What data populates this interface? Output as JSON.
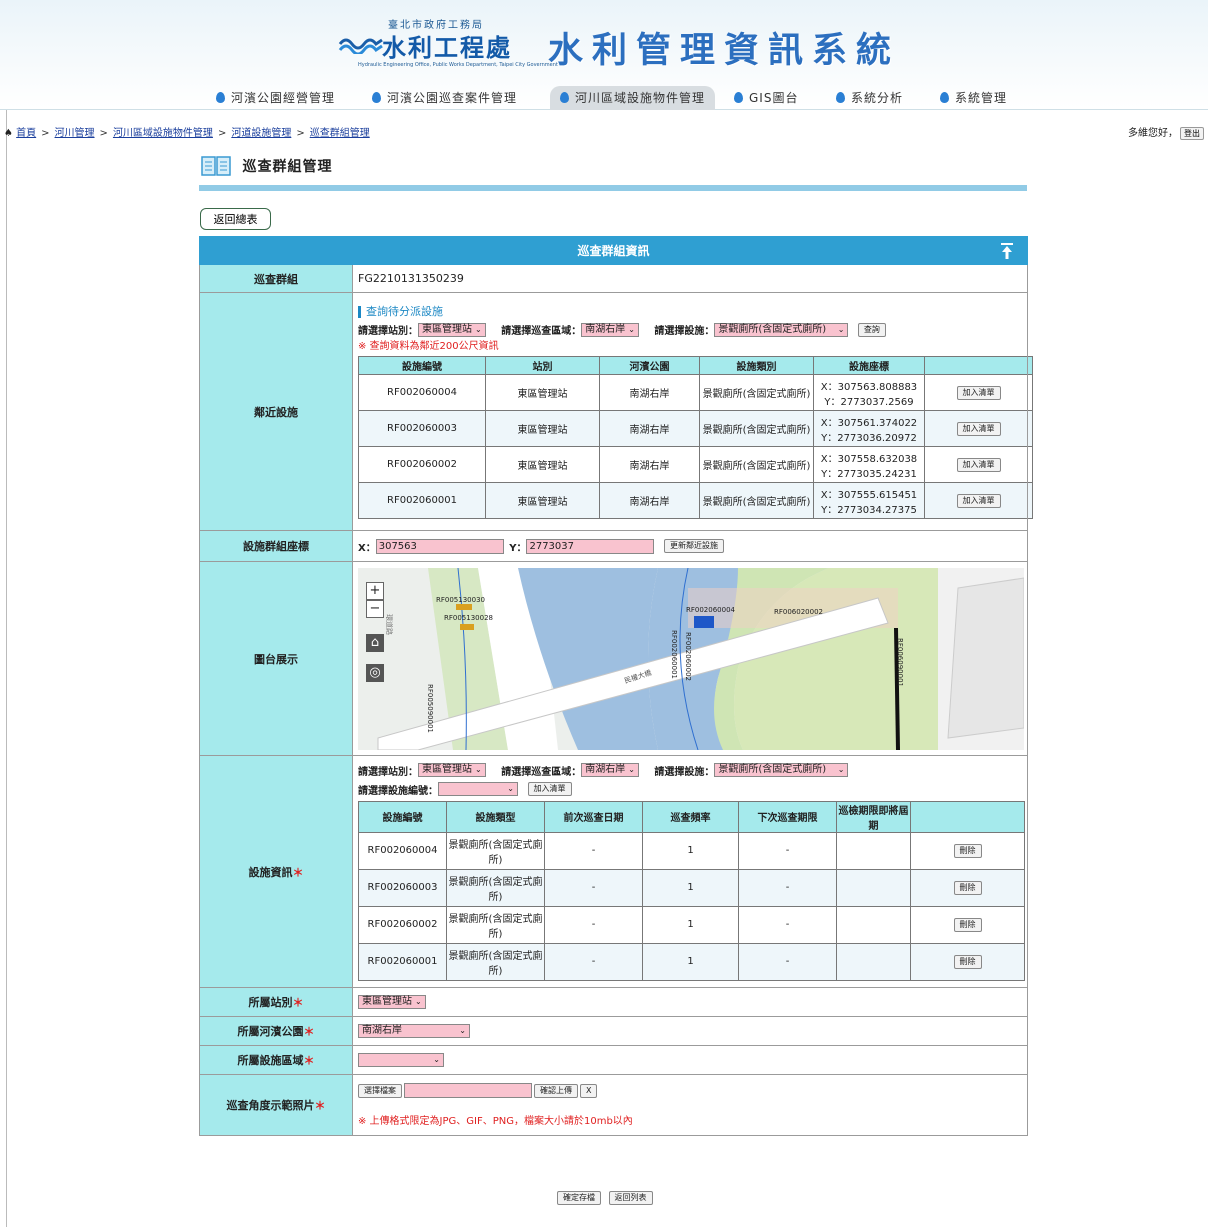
{
  "header": {
    "org_line1": "臺北市政府工務局",
    "org_line2": "水利工程處",
    "org_line3": "Hydraulic Engineering Office, Public Works Department, Taipei City Government",
    "system_title": "水利管理資訊系統"
  },
  "nav": {
    "items": [
      {
        "label": "河濱公園經營管理"
      },
      {
        "label": "河濱公園巡查案件管理"
      },
      {
        "label": "河川區域設施物件管理"
      },
      {
        "label": "GIS圖台"
      },
      {
        "label": "系統分析"
      },
      {
        "label": "系統管理"
      }
    ],
    "accent": "#2a7fd4"
  },
  "breadcrumb": {
    "items": [
      "首頁",
      "河川管理",
      "河川區域設施物件管理",
      "河道設施管理",
      "巡查群組管理"
    ],
    "separator": ">"
  },
  "user": {
    "greeting": "多維您好，",
    "logout": "登出"
  },
  "page_title": "巡查群組管理",
  "back_button": "返回總表",
  "panel": {
    "caption": "巡查群組資訊",
    "group_label": "巡查群組",
    "group_value": "FG2210131350239",
    "nearby_label": "鄰近設施",
    "query_heading": "查詢待分派設施",
    "q_station_label": "請選擇站別：",
    "q_station_value": "東區管理站",
    "q_area_label": "請選擇巡查區域：",
    "q_area_value": "南湖右岸",
    "q_facility_label": "請選擇設施：",
    "q_facility_value": "景觀廁所(含固定式廁所)",
    "query_button": "查詢",
    "query_note": "※ 查詢資料為鄰近200公尺資訊",
    "nearby_headers": [
      "設施編號",
      "站別",
      "河濱公園",
      "設施類別",
      "設施座標",
      ""
    ],
    "nearby_rows": [
      {
        "id": "RF002060004",
        "station": "東區管理站",
        "park": "南湖右岸",
        "type": "景觀廁所(含固定式廁所)",
        "x": "X：307563.808883",
        "y": "Y：2773037.2569",
        "btn": "加入清單"
      },
      {
        "id": "RF002060003",
        "station": "東區管理站",
        "park": "南湖右岸",
        "type": "景觀廁所(含固定式廁所)",
        "x": "X：307561.374022",
        "y": "Y：2773036.20972",
        "btn": "加入清單"
      },
      {
        "id": "RF002060002",
        "station": "東區管理站",
        "park": "南湖右岸",
        "type": "景觀廁所(含固定式廁所)",
        "x": "X：307558.632038",
        "y": "Y：2773035.24231",
        "btn": "加入清單"
      },
      {
        "id": "RF002060001",
        "station": "東區管理站",
        "park": "南湖右岸",
        "type": "景觀廁所(含固定式廁所)",
        "x": "X：307555.615451",
        "y": "Y：2773034.27375",
        "btn": "加入清單"
      }
    ],
    "coord_label": "設施群組座標",
    "coord_x_prefix": "X：",
    "coord_x": "307563",
    "coord_y_prefix": "Y：",
    "coord_y": "2773037",
    "coord_button": "更新鄰近設施",
    "map_label": "圖台展示",
    "map": {
      "labels": [
        "RF005130030",
        "RF005130028",
        "RF002060004",
        "RF006020002",
        "RF005090001",
        "RF006090001",
        "RF002060001",
        "RF002060002",
        "民權大橋",
        "環道路"
      ],
      "zoom_in": "+",
      "zoom_out": "−"
    },
    "info_label": "設施資訊",
    "i_station_label": "請選擇站別：",
    "i_station_value": "東區管理站",
    "i_area_label": "請選擇巡查區域：",
    "i_area_value": "南湖右岸",
    "i_facility_label": "請選擇設施：",
    "i_facility_value": "景觀廁所(含固定式廁所)",
    "i_id_label": "請選擇設施編號：",
    "i_add_button": "加入清單",
    "info_headers": [
      "設施編號",
      "設施類型",
      "前次巡查日期",
      "巡查頻率",
      "下次巡查期限",
      "巡檢期限即將屆期",
      ""
    ],
    "info_rows": [
      {
        "id": "RF002060004",
        "type": "景觀廁所(含固定式廁所)",
        "prev": "-",
        "freq": "1",
        "next": "-",
        "due": "",
        "btn": "刪除"
      },
      {
        "id": "RF002060003",
        "type": "景觀廁所(含固定式廁所)",
        "prev": "-",
        "freq": "1",
        "next": "-",
        "due": "",
        "btn": "刪除"
      },
      {
        "id": "RF002060002",
        "type": "景觀廁所(含固定式廁所)",
        "prev": "-",
        "freq": "1",
        "next": "-",
        "due": "",
        "btn": "刪除"
      },
      {
        "id": "RF002060001",
        "type": "景觀廁所(含固定式廁所)",
        "prev": "-",
        "freq": "1",
        "next": "-",
        "due": "",
        "btn": "刪除"
      }
    ],
    "station_label": "所屬站別",
    "station_value": "東區管理站",
    "park_label": "所屬河濱公園",
    "park_value": "南湖右岸",
    "area_label": "所屬設施區域",
    "area_value": "",
    "photo_label": "巡查角度示範照片",
    "photo_choose": "選擇檔案",
    "photo_upload": "確認上傳",
    "photo_clear": "X",
    "photo_note": "※ 上傳格式限定為JPG、GIF、PNG，檔案大小請於10mb以內"
  },
  "footer": {
    "save": "確定存檔",
    "back": "返回列表"
  },
  "colors": {
    "label_bg": "#a5eaec",
    "caption_bg": "#2f9fd2",
    "select_bg": "#f9c3cf",
    "required": "#e02020"
  }
}
